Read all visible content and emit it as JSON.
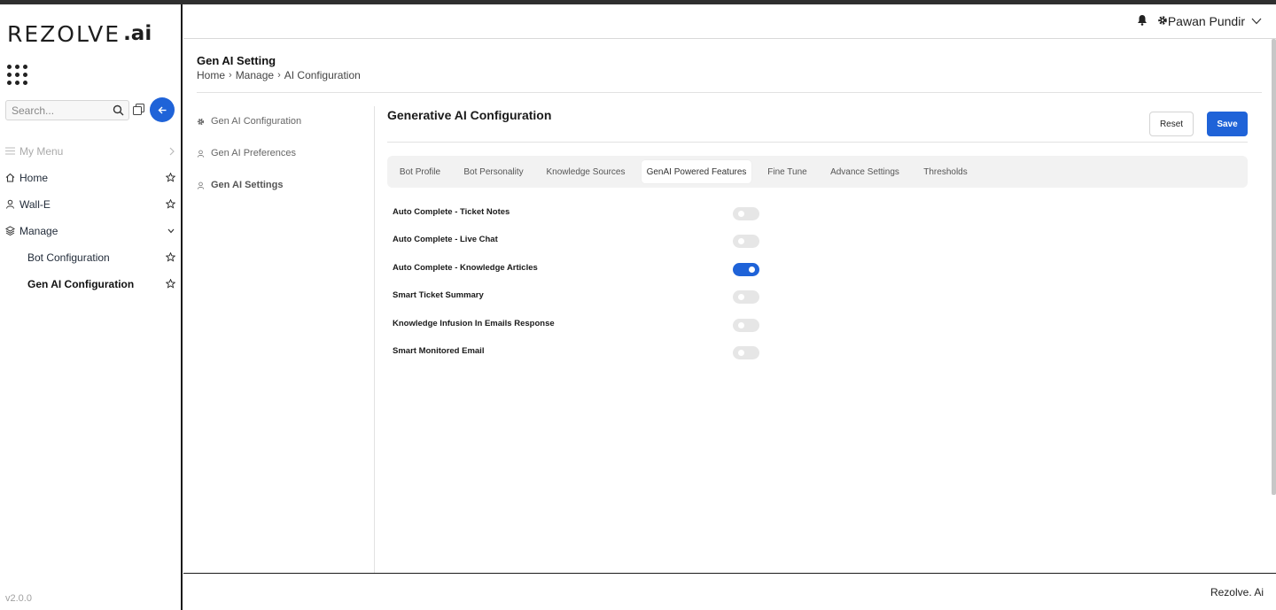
{
  "sidebar": {
    "logo_text": "REZOLVE",
    "logo_ai": ".ai",
    "search_placeholder": "Search...",
    "my_menu": "My Menu",
    "items": [
      {
        "label": "Home",
        "icon": "home-icon"
      },
      {
        "label": "Wall-E",
        "icon": "user-icon"
      },
      {
        "label": "Manage",
        "icon": "layers-icon"
      }
    ],
    "subitems": [
      {
        "label": "Bot Configuration"
      },
      {
        "label": "Gen AI Configuration"
      }
    ],
    "version": "v2.0.0"
  },
  "header": {
    "user_name": "Pawan Pundir"
  },
  "page": {
    "title": "Gen AI Setting",
    "breadcrumb": [
      "Home",
      "Manage",
      "AI Configuration"
    ]
  },
  "subnav": [
    {
      "label": "Gen AI Configuration",
      "icon": "gear-icon"
    },
    {
      "label": "Gen AI Preferences",
      "icon": "user-icon"
    },
    {
      "label": "Gen AI Settings",
      "icon": "user-icon"
    }
  ],
  "section": {
    "title": "Generative AI Configuration",
    "reset_label": "Reset",
    "save_label": "Save"
  },
  "tabs": [
    {
      "label": "Bot Profile"
    },
    {
      "label": "Bot Personality"
    },
    {
      "label": "Knowledge Sources"
    },
    {
      "label": "GenAI Powered Features",
      "active": true
    },
    {
      "label": "Fine Tune"
    },
    {
      "label": "Advance Settings"
    },
    {
      "label": "Thresholds"
    }
  ],
  "features": [
    {
      "label": "Auto Complete - Ticket Notes",
      "enabled": false
    },
    {
      "label": "Auto Complete - Live Chat",
      "enabled": false
    },
    {
      "label": "Auto Complete - Knowledge Articles",
      "enabled": true
    },
    {
      "label": "Smart Ticket Summary",
      "enabled": false
    },
    {
      "label": "Knowledge Infusion In Emails Response",
      "enabled": false
    },
    {
      "label": "Smart Monitored Email",
      "enabled": false
    }
  ],
  "footer": {
    "brand": "Rezolve. Ai"
  },
  "colors": {
    "accent": "#1f63d8",
    "logo_check": "#7cb518"
  }
}
